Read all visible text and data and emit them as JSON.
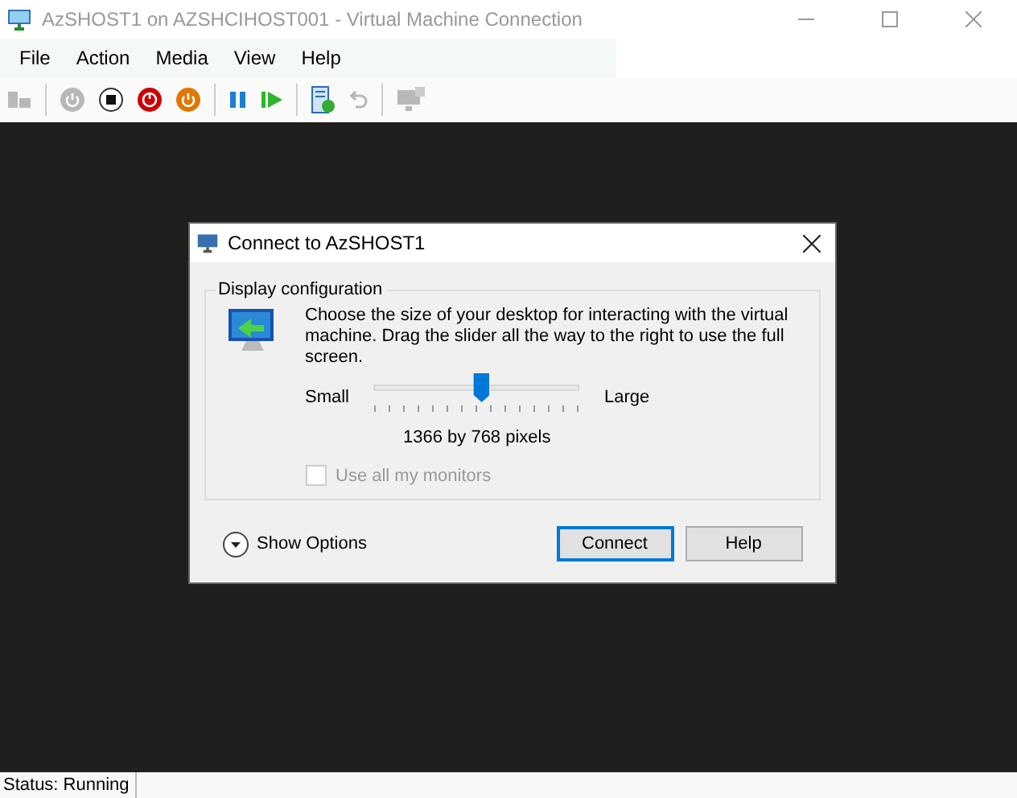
{
  "window": {
    "title": "AzSHOST1 on AZSHCIHOST001 - Virtual Machine Connection"
  },
  "menu": [
    "File",
    "Action",
    "Media",
    "View",
    "Help"
  ],
  "toolbar": [
    {
      "kind": "ctrlaltdel",
      "disabled": true
    },
    {
      "kind": "sep"
    },
    {
      "kind": "start",
      "disabled": true
    },
    {
      "kind": "stop",
      "disabled": false
    },
    {
      "kind": "poweroff",
      "disabled": false
    },
    {
      "kind": "shutdown",
      "disabled": false
    },
    {
      "kind": "sep"
    },
    {
      "kind": "pause",
      "disabled": false
    },
    {
      "kind": "resume",
      "disabled": false
    },
    {
      "kind": "sep"
    },
    {
      "kind": "checkpoint",
      "disabled": false
    },
    {
      "kind": "revert",
      "disabled": true
    },
    {
      "kind": "sep"
    },
    {
      "kind": "enhanced",
      "disabled": true
    }
  ],
  "dialog": {
    "title": "Connect to AzSHOST1",
    "group_title": "Display configuration",
    "description": "Choose the size of your desktop for interacting with the virtual machine. Drag the slider all the way to the right to use the full screen.",
    "slider": {
      "min_label": "Small",
      "max_label": "Large",
      "level": 0.53
    },
    "resolution": "1366 by 768 pixels",
    "use_all_monitors": {
      "label": "Use all my monitors",
      "checked": false,
      "disabled": true
    },
    "show_options": "Show Options",
    "buttons": [
      {
        "label": "Connect",
        "default": true
      },
      {
        "label": "Help",
        "default": false
      }
    ]
  },
  "status_bar": {
    "text": "Status: Running"
  }
}
